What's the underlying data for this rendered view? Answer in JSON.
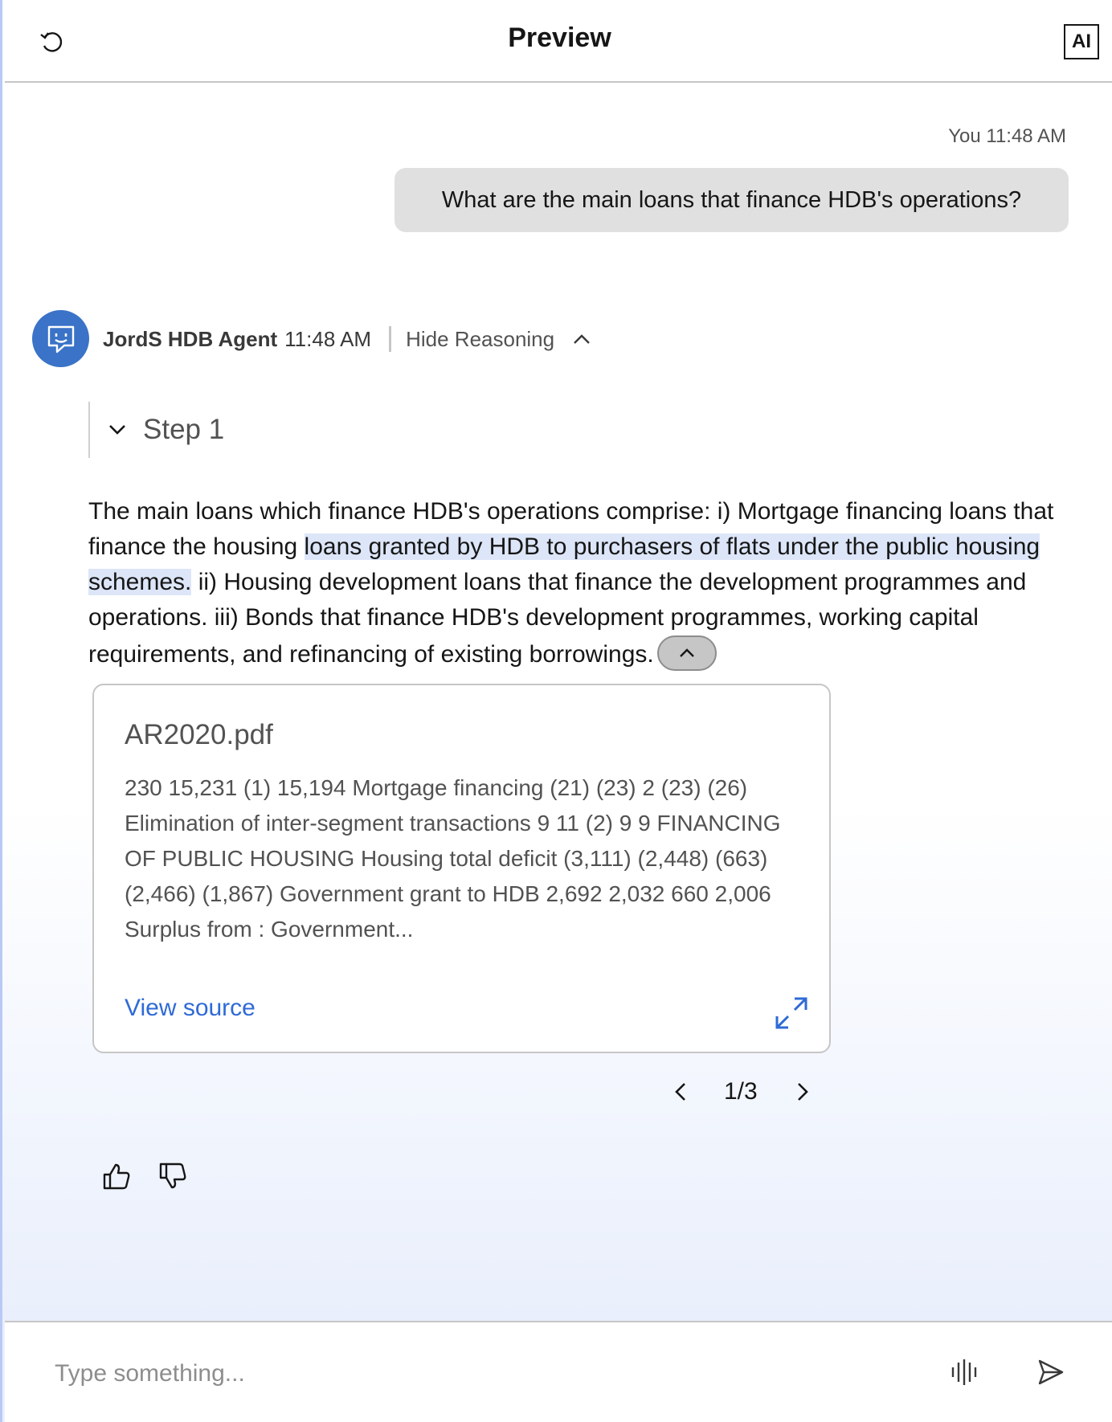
{
  "header": {
    "title": "Preview",
    "ai_badge": "AI",
    "restart_icon": "restart-icon"
  },
  "user_message": {
    "meta": "You 11:48 AM",
    "text": "What are the main loans that finance HDB's operations?"
  },
  "agent": {
    "name": "JordS HDB Agent",
    "time": "11:48 AM",
    "hide_reasoning": "Hide Reasoning",
    "avatar_icon": "chat-bot-icon"
  },
  "reasoning": {
    "step_label": "Step 1"
  },
  "answer": {
    "part1": "The main loans which finance HDB's operations comprise: i) Mortgage financing loans that finance the housing ",
    "highlight": "loans granted by HDB to purchasers of flats under the public housing schemes.",
    "part2": " ii) Housing development loans that finance the development programmes and operations. iii) Bonds that finance HDB's development programmes, working capital requirements, and refinancing of existing borrowings."
  },
  "source_card": {
    "title": "AR2020.pdf",
    "excerpt": "230 15,231 (1) 15,194 Mortgage financing (21) (23) 2 (23) (26) Elimination of inter-segment transactions 9 11 (2) 9 9 FINANCING OF PUBLIC HOUSING Housing total deficit (3,111) (2,448) (663) (2,466) (1,867) Government grant to HDB 2,692 2,032 660 2,006 Surplus from : Government...",
    "view_source": "View source"
  },
  "pager": {
    "count": "1/3"
  },
  "input": {
    "placeholder": "Type something..."
  },
  "colors": {
    "accent": "#2f6ad6",
    "avatar": "#3a73c7",
    "highlight": "#dde6f8",
    "user_bubble": "#e0e0e0"
  }
}
